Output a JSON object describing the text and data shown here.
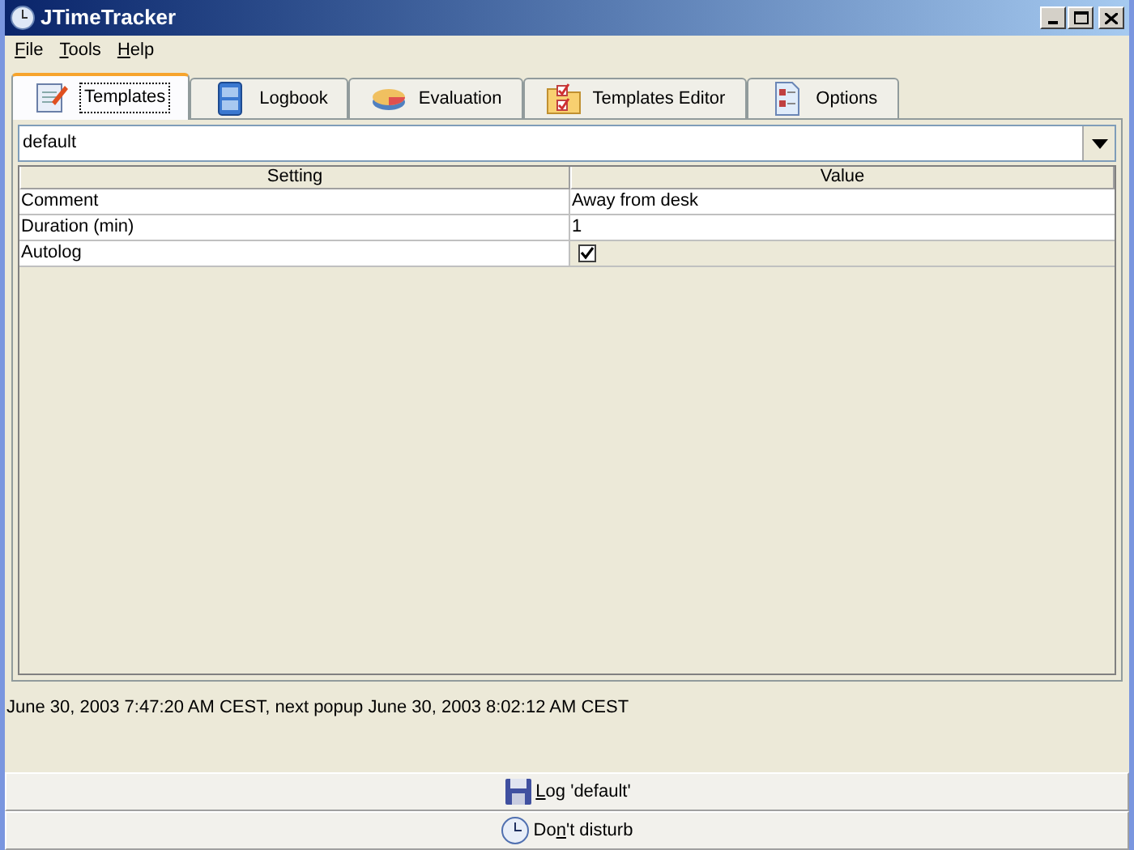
{
  "window": {
    "title": "JTimeTracker"
  },
  "menu": [
    {
      "label": "File"
    },
    {
      "label": "Tools"
    },
    {
      "label": "Help"
    }
  ],
  "tabs": [
    {
      "label": "Templates",
      "selected": true
    },
    {
      "label": "Logbook",
      "selected": false
    },
    {
      "label": "Evaluation",
      "selected": false
    },
    {
      "label": "Templates Editor",
      "selected": false
    },
    {
      "label": "Options",
      "selected": false
    }
  ],
  "template_combo": {
    "value": "default"
  },
  "table": {
    "columns": [
      "Setting",
      "Value"
    ],
    "rows": [
      {
        "kind": "text",
        "setting": "Comment",
        "value": "Away from desk"
      },
      {
        "kind": "text",
        "setting": "Duration (min)",
        "value": "1"
      },
      {
        "kind": "checkbox",
        "setting": "Autolog",
        "checked": true
      }
    ]
  },
  "status": "June 30, 2003 7:47:20 AM CEST, next popup June 30, 2003 8:02:12 AM CEST",
  "buttons": [
    {
      "label": "Log 'default'"
    },
    {
      "label": "Don't disturb"
    }
  ]
}
